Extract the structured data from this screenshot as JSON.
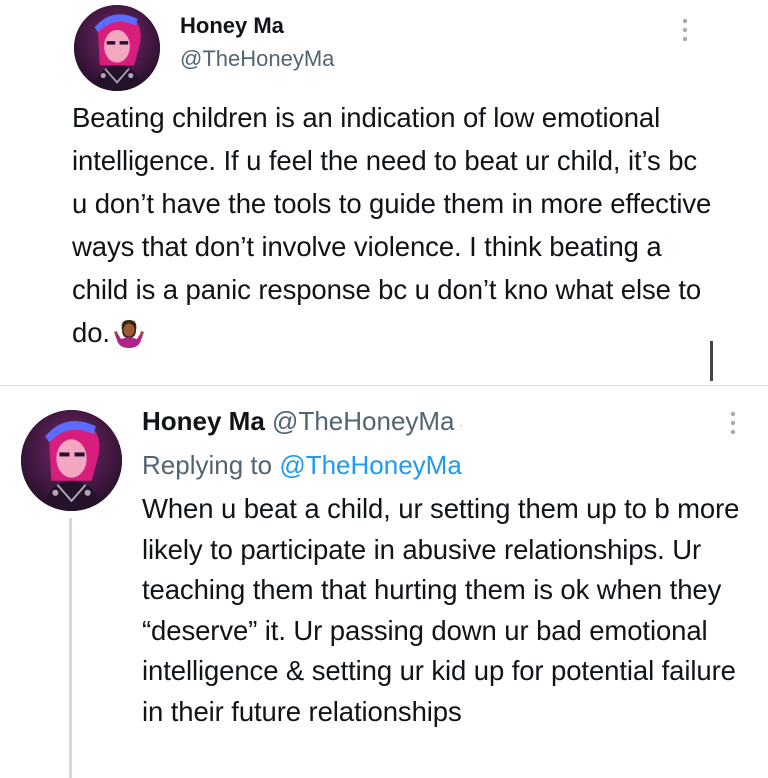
{
  "tweet": {
    "author_name": "Honey Ma",
    "author_handle": "@TheHoneyMa",
    "text": "Beating children is an indication of low emotional intelligence. If u feel the need to beat ur child, it’s bc u don’t have the tools to guide them in more effective ways that don’t involve violence. I think beating a child is a panic response bc u don’t kno what else to do.",
    "emoji_icon": "person-shrugging-emoji"
  },
  "reply": {
    "author_name": "Honey Ma",
    "author_handle": "@TheHoneyMa",
    "replying_label": "Replying to",
    "replying_handle": "@TheHoneyMa",
    "text": "When u beat a child, ur setting them up to b more likely to participate in abusive relationships. Ur teaching them that hurting them is ok when they “deserve” it. Ur passing down ur bad emotional intelligence & setting ur kid up for potential failure in their future relationships"
  },
  "colors": {
    "text": "#0f1419",
    "secondary": "#536471",
    "link": "#1d9bf0",
    "divider": "#d6dde2"
  }
}
